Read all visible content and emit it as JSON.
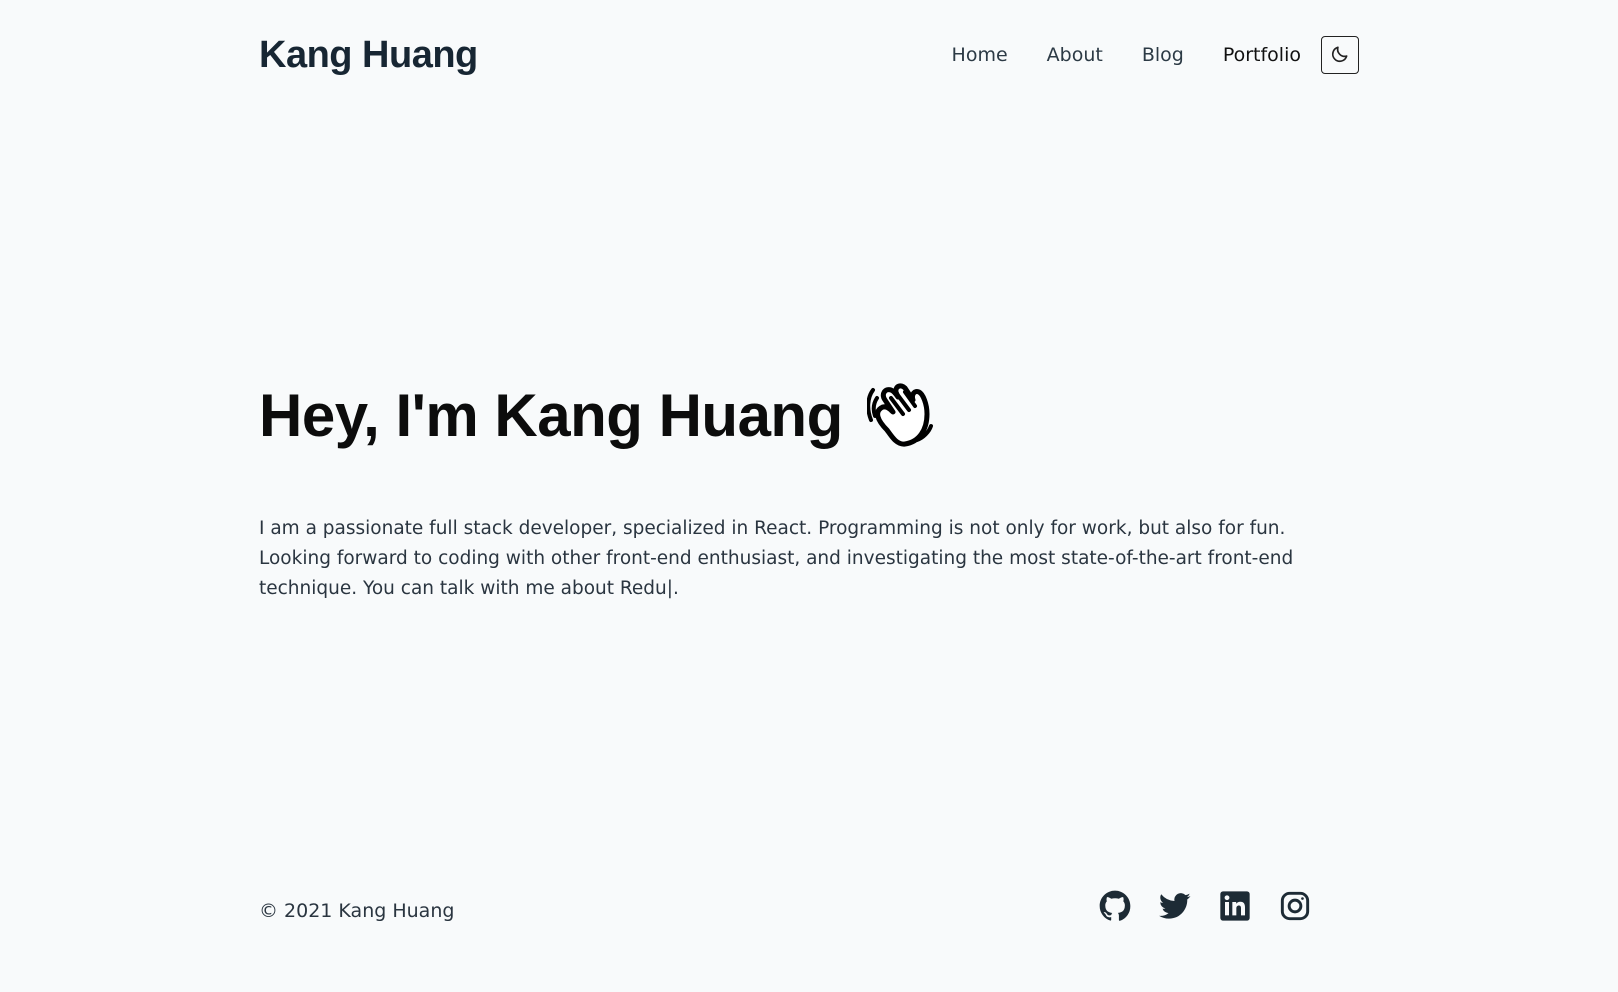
{
  "header": {
    "brand": "Kang Huang",
    "nav": [
      {
        "label": "Home"
      },
      {
        "label": "About"
      },
      {
        "label": "Blog"
      },
      {
        "label": "Portfolio"
      }
    ],
    "theme_toggle_icon": "moon-icon"
  },
  "hero": {
    "title": "Hey, I'm Kang Huang",
    "wave_icon": "waving-hand-icon",
    "intro": "I am a passionate full stack developer, specialized in React. Programming is not only for work, but also for fun. Looking forward to coding with other front-end enthusiast, and investigating the most state-of-the-art front-end technique. You can talk with me about Redu|."
  },
  "footer": {
    "copyright": "© 2021 Kang Huang",
    "socials": [
      "github-icon",
      "twitter-icon",
      "linkedin-icon",
      "instagram-icon"
    ]
  },
  "colors": {
    "background": "#f8fafb",
    "text": "#1f2a33",
    "heading": "#0c0c0c"
  }
}
